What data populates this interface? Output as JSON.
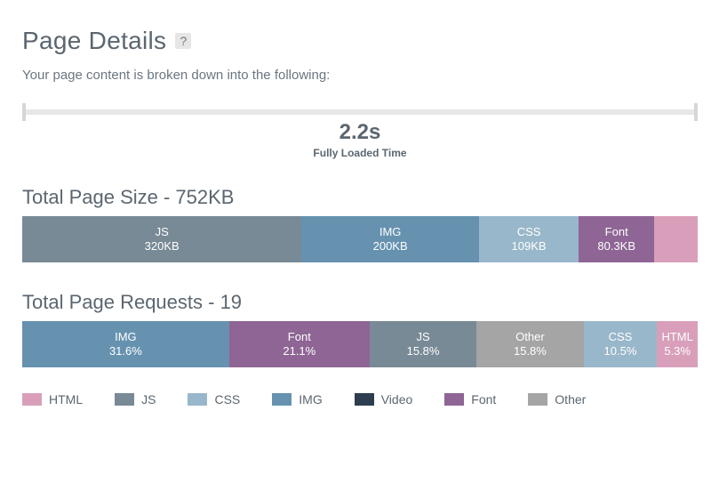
{
  "header": {
    "title": "Page Details",
    "help_label": "?",
    "subtitle": "Your page content is broken down into the following:"
  },
  "timeline": {
    "value": "2.2s",
    "label": "Fully Loaded Time"
  },
  "colors": {
    "HTML": "#d99fba",
    "JS": "#788a96",
    "CSS": "#99b7ca",
    "IMG": "#6692b0",
    "Video": "#2c3e50",
    "Font": "#8e6595",
    "Other": "#a5a5a5"
  },
  "size_section": {
    "title": "Total Page Size - 752KB"
  },
  "requests_section": {
    "title": "Total Page Requests - 19"
  },
  "legend": [
    {
      "label": "HTML",
      "color": "HTML"
    },
    {
      "label": "JS",
      "color": "JS"
    },
    {
      "label": "CSS",
      "color": "CSS"
    },
    {
      "label": "IMG",
      "color": "IMG"
    },
    {
      "label": "Video",
      "color": "Video"
    },
    {
      "label": "Font",
      "color": "Font"
    },
    {
      "label": "Other",
      "color": "Other"
    }
  ],
  "chart_data": [
    {
      "type": "bar",
      "title": "Total Page Size - 752KB",
      "unit": "KB",
      "total": 752,
      "segments": [
        {
          "category": "JS",
          "value": 320,
          "display": "320KB",
          "show_label": true
        },
        {
          "category": "IMG",
          "value": 200,
          "display": "200KB",
          "show_label": true
        },
        {
          "category": "CSS",
          "value": 109,
          "display": "109KB",
          "show_label": true
        },
        {
          "category": "Font",
          "value": 80.3,
          "display": "80.3KB",
          "show_label": true
        },
        {
          "category": "HTML",
          "value": 42.7,
          "display": "42.7KB",
          "show_label": false
        }
      ]
    },
    {
      "type": "bar",
      "title": "Total Page Requests - 19",
      "unit": "%",
      "total": 100,
      "segments": [
        {
          "category": "IMG",
          "value": 31.6,
          "display": "31.6%",
          "show_label": true
        },
        {
          "category": "Font",
          "value": 21.1,
          "display": "21.1%",
          "show_label": true
        },
        {
          "category": "JS",
          "value": 15.8,
          "display": "15.8%",
          "show_label": true
        },
        {
          "category": "Other",
          "value": 15.8,
          "display": "15.8%",
          "show_label": true
        },
        {
          "category": "CSS",
          "value": 10.5,
          "display": "10.5%",
          "show_label": true
        },
        {
          "category": "HTML",
          "value": 5.3,
          "display": "5.3%",
          "show_label": true
        }
      ]
    }
  ]
}
